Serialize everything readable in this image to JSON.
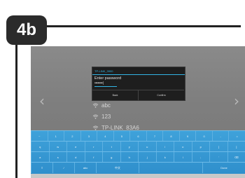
{
  "step_label": "4b",
  "dialog": {
    "network_name": "TP-LINK_3900",
    "prompt": "Enter password",
    "password_masked": "••••••••|",
    "back_label": "Back",
    "confirm_label": "Confirm"
  },
  "networks": [
    {
      "name": "abc"
    },
    {
      "name": "123"
    },
    {
      "name": "TP-LINK_83A6"
    }
  ],
  "keyboard": {
    "row1": [
      "~",
      "1",
      "2",
      "3",
      "4",
      "5",
      "6",
      "7",
      "8",
      "9",
      "0",
      "-",
      "="
    ],
    "row2": [
      "q",
      "w",
      "e",
      "r",
      "t",
      "y",
      "u",
      "i",
      "o",
      "p",
      "[",
      "]"
    ],
    "row3": [
      "a",
      "s",
      "d",
      "f",
      "g",
      "h",
      "j",
      "k",
      "l",
      ";",
      "'",
      "⌫"
    ],
    "row4": [
      "⇧",
      "/",
      "abc",
      "中文",
      "space",
      "Done"
    ]
  },
  "icons": {
    "left_arrow": "chevron-left-icon",
    "right_arrow": "chevron-right-icon",
    "wifi": "wifi-icon"
  },
  "colors": {
    "accent": "#33b5e5",
    "keyboard": "#3a9ad6"
  }
}
